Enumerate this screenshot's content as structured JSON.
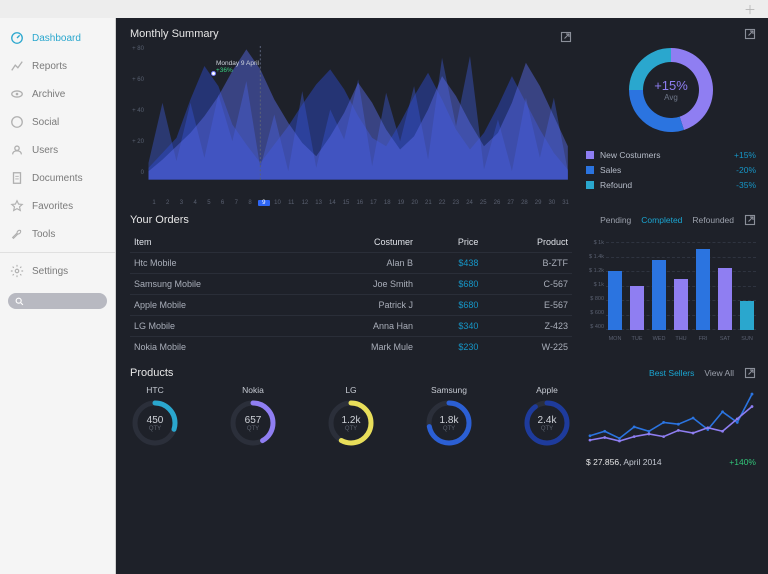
{
  "sidebar": {
    "items": [
      {
        "label": "Dashboard",
        "icon": "dashboard-icon"
      },
      {
        "label": "Reports",
        "icon": "reports-icon"
      },
      {
        "label": "Archive",
        "icon": "archive-icon"
      },
      {
        "label": "Social",
        "icon": "social-icon"
      },
      {
        "label": "Users",
        "icon": "users-icon"
      },
      {
        "label": "Documents",
        "icon": "documents-icon"
      },
      {
        "label": "Favorites",
        "icon": "favorites-icon"
      },
      {
        "label": "Tools",
        "icon": "tools-icon"
      },
      {
        "label": "Settings",
        "icon": "settings-icon"
      }
    ],
    "active_index": 0
  },
  "summary": {
    "title": "Monthly Summary",
    "tooltip_date": "Monday 9 April",
    "tooltip_change": "+36%",
    "donut_value": "+15%",
    "donut_label": "Avg",
    "legend": [
      {
        "label": "New Costumers",
        "value": "+15%",
        "color": "#8f7ef2"
      },
      {
        "label": "Sales",
        "value": "-20%",
        "color": "#2b74e0"
      },
      {
        "label": "Refound",
        "value": "-35%",
        "color": "#2aa7ce"
      }
    ]
  },
  "orders": {
    "title": "Your Orders",
    "tabs": [
      "Pending",
      "Completed",
      "Refounded"
    ],
    "active_tab": 1,
    "columns": [
      "Item",
      "Costumer",
      "Price",
      "Product"
    ],
    "rows": [
      {
        "item": "Htc Mobile",
        "costumer": "Alan B",
        "price": "$438",
        "product": "B-ZTF"
      },
      {
        "item": "Samsung Mobile",
        "costumer": "Joe Smith",
        "price": "$680",
        "product": "C-567"
      },
      {
        "item": "Apple Mobile",
        "costumer": "Patrick J",
        "price": "$680",
        "product": "E-567"
      },
      {
        "item": "LG Mobile",
        "costumer": "Anna Han",
        "price": "$340",
        "product": "Z-423"
      },
      {
        "item": "Nokia Mobile",
        "costumer": "Mark Mule",
        "price": "$230",
        "product": "W-225"
      }
    ]
  },
  "bars": {
    "yticks": [
      "$ 1k",
      "$ 1.4k",
      "$ 1.2k",
      "$ 1k",
      "$ 800",
      "$ 600",
      "$ 400"
    ],
    "days": [
      "MON",
      "TUE",
      "WED",
      "THU",
      "FRI",
      "SAT",
      "SUN"
    ]
  },
  "products": {
    "title": "Products",
    "tabs": [
      "Best Sellers",
      "View All"
    ],
    "active_tab": 0,
    "items": [
      {
        "name": "HTC",
        "qty": "450",
        "sub": "QTY",
        "color": "#2aa7ce",
        "pct": 0.3
      },
      {
        "name": "Nokia",
        "qty": "657",
        "sub": "QTY",
        "color": "#8f7ef2",
        "pct": 0.42
      },
      {
        "name": "LG",
        "qty": "1.2k",
        "sub": "QTY",
        "color": "#e8de5a",
        "pct": 0.58
      },
      {
        "name": "Samsung",
        "qty": "1.8k",
        "sub": "QTY",
        "color": "#2b5fd4",
        "pct": 0.72
      },
      {
        "name": "Apple",
        "qty": "2.4k",
        "sub": "QTY",
        "color": "#1e3b9c",
        "pct": 0.9
      }
    ]
  },
  "trend": {
    "amount": "$ 27.856",
    "period": ", April 2014",
    "change": "+140%"
  },
  "chart_data": [
    {
      "type": "area",
      "title": "Monthly Summary",
      "x": [
        1,
        2,
        3,
        4,
        5,
        6,
        7,
        8,
        9,
        10,
        11,
        12,
        13,
        14,
        15,
        16,
        17,
        18,
        19,
        20,
        21,
        22,
        23,
        24,
        25,
        26,
        27,
        28,
        29,
        30,
        31
      ],
      "yticks": [
        80,
        60,
        40,
        20,
        0
      ],
      "ylim": [
        0,
        80
      ],
      "series": [
        {
          "name": "series-a",
          "values": [
            10,
            46,
            11,
            46,
            13,
            51,
            23,
            59,
            7,
            39,
            5,
            53,
            7,
            42,
            24,
            60,
            8,
            52,
            23,
            56,
            12,
            73,
            32,
            74,
            6,
            36,
            5,
            49,
            13,
            49,
            5
          ]
        },
        {
          "name": "series-b",
          "values": [
            7,
            16,
            25,
            48,
            68,
            56,
            33,
            21,
            10,
            21,
            32,
            45,
            57,
            66,
            54,
            38,
            25,
            20,
            34,
            50,
            64,
            48,
            30,
            18,
            28,
            44,
            62,
            46,
            30,
            16,
            6
          ]
        },
        {
          "name": "series-c",
          "values": [
            5,
            12,
            20,
            28,
            38,
            50,
            65,
            78,
            66,
            48,
            34,
            22,
            14,
            26,
            40,
            58,
            46,
            30,
            18,
            26,
            42,
            62,
            50,
            34,
            20,
            28,
            46,
            70,
            56,
            38,
            20
          ]
        }
      ],
      "selected_x": 9,
      "tooltip": {
        "x": 9,
        "label": "Monday 9 April",
        "change": "+36%"
      }
    },
    {
      "type": "pie",
      "title": "+15% Avg",
      "series": [
        {
          "name": "New Costumers",
          "value": 45,
          "color": "#8f7ef2"
        },
        {
          "name": "Sales",
          "value": 30,
          "color": "#2b74e0"
        },
        {
          "name": "Refound",
          "value": 25,
          "color": "#2aa7ce"
        }
      ]
    },
    {
      "type": "bar",
      "categories": [
        "MON",
        "TUE",
        "WED",
        "THU",
        "FRI",
        "SAT",
        "SUN"
      ],
      "values": [
        1200,
        1000,
        1350,
        1100,
        1500,
        1250,
        800
      ],
      "colors": [
        "#2b74e0",
        "#8f7ef2",
        "#2b74e0",
        "#8f7ef2",
        "#2b74e0",
        "#8f7ef2",
        "#2aa7ce"
      ],
      "ylabel": "$",
      "ylim": [
        400,
        1600
      ]
    },
    {
      "type": "line",
      "x": [
        1,
        2,
        3,
        4,
        5,
        6,
        7,
        8,
        9,
        10,
        11,
        12
      ],
      "series": [
        {
          "name": "a",
          "values": [
            15,
            20,
            12,
            25,
            20,
            30,
            28,
            35,
            22,
            42,
            30,
            62
          ],
          "color": "#2b74e0"
        },
        {
          "name": "b",
          "values": [
            10,
            13,
            9,
            14,
            17,
            14,
            21,
            18,
            24,
            20,
            34,
            48
          ],
          "color": "#8f7ef2"
        }
      ],
      "ylim": [
        0,
        70
      ]
    }
  ]
}
